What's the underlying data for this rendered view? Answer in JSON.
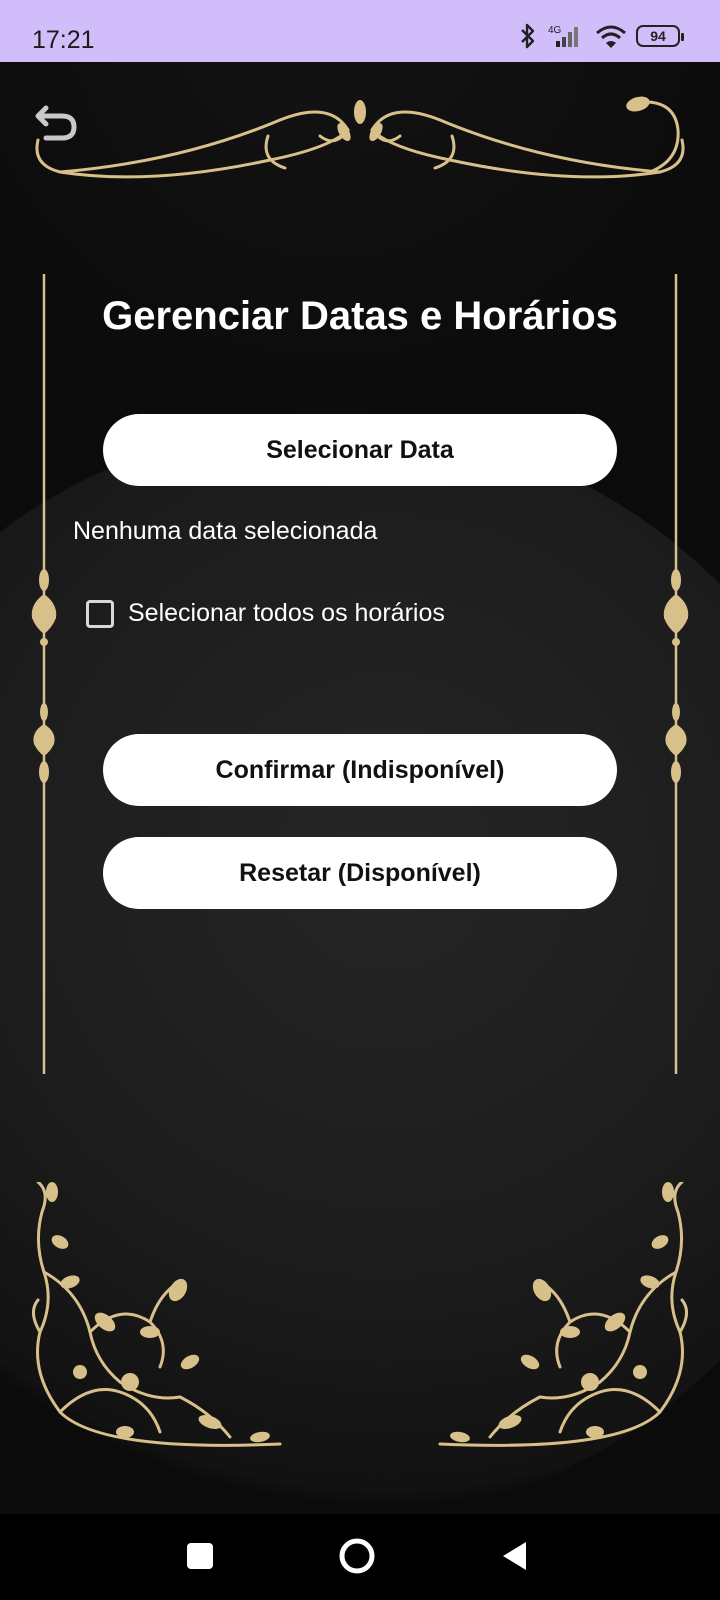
{
  "status_bar": {
    "time": "17:21",
    "network": "4G",
    "battery": "94",
    "icons": [
      "bluetooth-icon",
      "signal-icon",
      "wifi-icon",
      "battery-icon"
    ]
  },
  "page": {
    "title": "Gerenciar Datas e Horários",
    "select_date_button": "Selecionar Data",
    "selected_date_text": "Nenhuma data selecionada",
    "select_all_label": "Selecionar todos os horários",
    "select_all_checked": false,
    "confirm_button": "Confirmar (Indisponível)",
    "reset_button": "Resetar (Disponível)"
  },
  "colors": {
    "status_bar": "#d2bdfb",
    "background": "#0b0b0b",
    "ornament_gold": "#d8c08a",
    "button_bg": "#ffffff",
    "text": "#ffffff"
  },
  "nav_bar": {
    "buttons": [
      "recents-icon",
      "home-icon",
      "back-icon"
    ]
  }
}
